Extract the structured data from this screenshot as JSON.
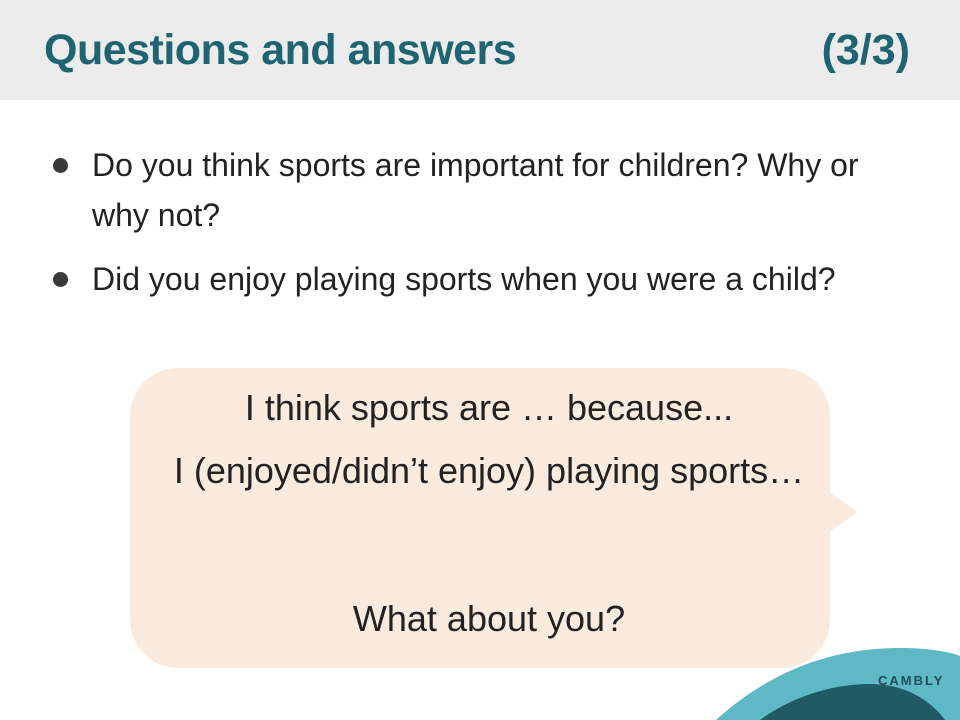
{
  "header": {
    "title": "Questions and answers",
    "page_indicator": "(3/3)"
  },
  "questions": [
    {
      "text": "Do you think sports are important for children? Why or why not?"
    },
    {
      "text": "Did you enjoy playing sports when you were a child?"
    }
  ],
  "speech_bubble": {
    "line1": "I think sports are … because...",
    "line2": "I (enjoyed/didn’t enjoy) playing sports…",
    "line3": "What about you?"
  },
  "branding": {
    "logo": "CAMBLY"
  },
  "colors": {
    "title": "#1f6473",
    "header_bg": "#ececec",
    "bubble_bg": "#fbebdf",
    "wave_light": "#5fb8c6",
    "wave_dark": "#1f5a66"
  }
}
